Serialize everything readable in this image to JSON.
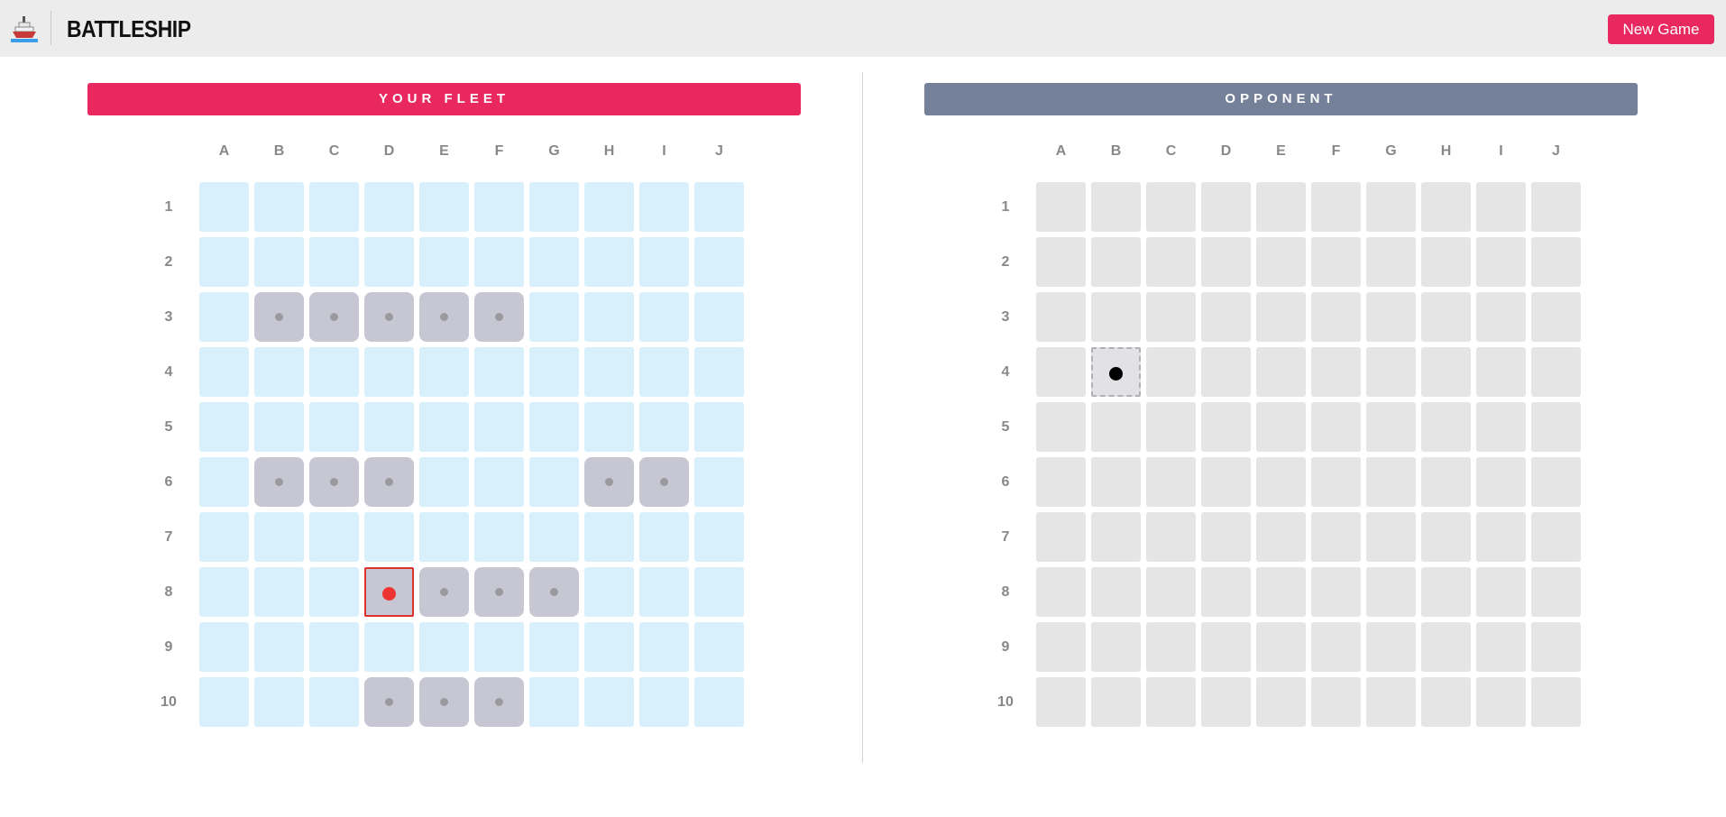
{
  "app": {
    "title": "BATTLESHIP",
    "new_game_label": "New Game",
    "logo_icon": "ship-icon"
  },
  "player_board": {
    "title": "YOUR FLEET",
    "header_color": "#e8285f",
    "columns": [
      "A",
      "B",
      "C",
      "D",
      "E",
      "F",
      "G",
      "H",
      "I",
      "J"
    ],
    "rows": [
      "1",
      "2",
      "3",
      "4",
      "5",
      "6",
      "7",
      "8",
      "9",
      "10"
    ],
    "ship_cells": [
      "B3",
      "C3",
      "D3",
      "E3",
      "F3",
      "B6",
      "C6",
      "D6",
      "H6",
      "I6",
      "E8",
      "F8",
      "G8",
      "D10",
      "E10",
      "F10"
    ],
    "hit_cells": [
      "D8"
    ],
    "miss_cells": []
  },
  "opponent_board": {
    "title": "OPPONENT",
    "header_color": "#758099",
    "columns": [
      "A",
      "B",
      "C",
      "D",
      "E",
      "F",
      "G",
      "H",
      "I",
      "J"
    ],
    "rows": [
      "1",
      "2",
      "3",
      "4",
      "5",
      "6",
      "7",
      "8",
      "9",
      "10"
    ],
    "hit_cells": [],
    "miss_cells": [
      "B4"
    ]
  },
  "colors": {
    "water": "#d8f0fb",
    "ship": "#c7c7d3",
    "fog": "#e5e5e5",
    "hit": "#ee3333",
    "miss": "#000000"
  }
}
